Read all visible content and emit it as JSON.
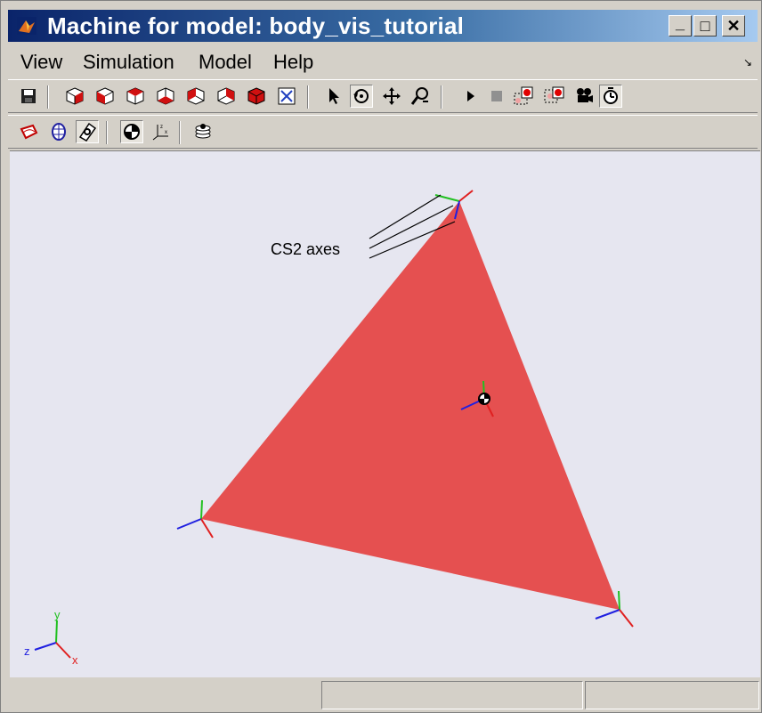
{
  "window": {
    "title": "Machine for model: body_vis_tutorial",
    "controls": {
      "minimize": "_",
      "maximize": "□",
      "close": "✕"
    }
  },
  "menu": {
    "items": [
      {
        "label": "View"
      },
      {
        "label": "Simulation"
      },
      {
        "label": "Model"
      },
      {
        "label": "Help"
      }
    ]
  },
  "toolbar1": {
    "tools": [
      "save-icon",
      "view-front-icon",
      "view-back-icon",
      "view-left-icon",
      "view-right-icon",
      "view-top-icon",
      "view-bottom-icon",
      "view-isometric-icon",
      "fit-to-view-icon",
      "select-pointer-icon",
      "rotate-icon",
      "pan-icon",
      "zoom-icon",
      "play-icon",
      "stop-icon",
      "record-start-icon",
      "record-end-icon",
      "camera-icon",
      "timer-icon"
    ]
  },
  "toolbar2": {
    "tools": [
      "ellipsoid-icon",
      "convex-hull-icon",
      "cg-marker-icon",
      "center-of-gravity-icon",
      "axes-icon",
      "layers-icon"
    ]
  },
  "viewport": {
    "annotation": "CS2 axes",
    "body_color": "#e55050",
    "background": "#e6e6f0",
    "triad_labels": {
      "x": "x",
      "y": "y",
      "z": "z"
    },
    "axis_colors": {
      "x": "#e02020",
      "y": "#20c020",
      "z": "#2020e0"
    }
  },
  "status": {
    "left": "",
    "middle": "",
    "right": ""
  }
}
